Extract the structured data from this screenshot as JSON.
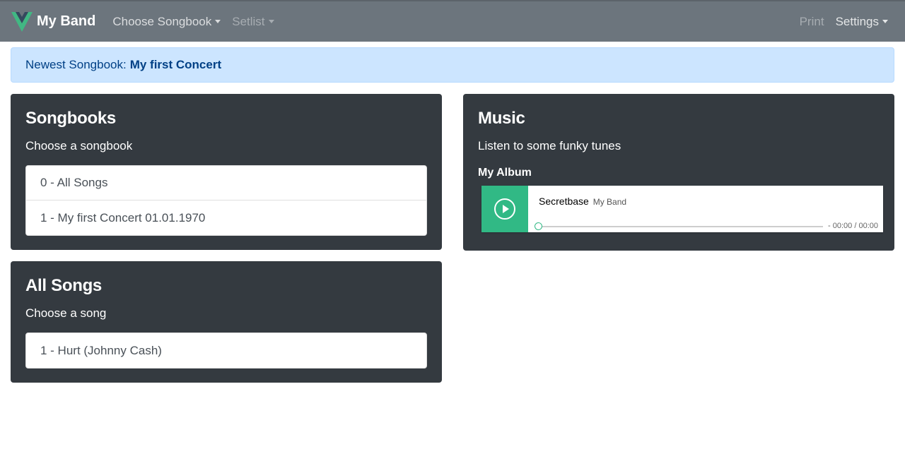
{
  "navbar": {
    "brand": "My Band",
    "left_items": [
      {
        "label": "Choose Songbook",
        "state": "normal"
      },
      {
        "label": "Setlist",
        "state": "disabled"
      }
    ],
    "print_label": "Print",
    "settings_label": "Settings"
  },
  "alert": {
    "prefix": "Newest Songbook:",
    "songbook": "My first Concert"
  },
  "songbooks": {
    "title": "Songbooks",
    "subtitle": "Choose a songbook",
    "items": [
      "0 - All Songs",
      "1 - My first Concert 01.01.1970"
    ]
  },
  "all_songs": {
    "title": "All Songs",
    "subtitle": "Choose a song",
    "items": [
      "1 - Hurt (Johnny Cash)"
    ]
  },
  "music": {
    "title": "Music",
    "subtitle": "Listen to some funky tunes",
    "album": "My Album",
    "player": {
      "song": "Secretbase",
      "artist": "My Band",
      "time": "- 00:00 / 00:00",
      "progress": 0,
      "accent": "#31b985"
    }
  },
  "colors": {
    "navbar": "#6c757d",
    "card": "#343a40",
    "alert_bg": "#cce5ff",
    "alert_text": "#004085",
    "brand_logo_green": "#41b883",
    "brand_logo_dark": "#35495e"
  },
  "icons": {
    "brand": "vue-logo-icon",
    "play": "play-circle-icon",
    "dropdown": "caret-down-icon"
  }
}
